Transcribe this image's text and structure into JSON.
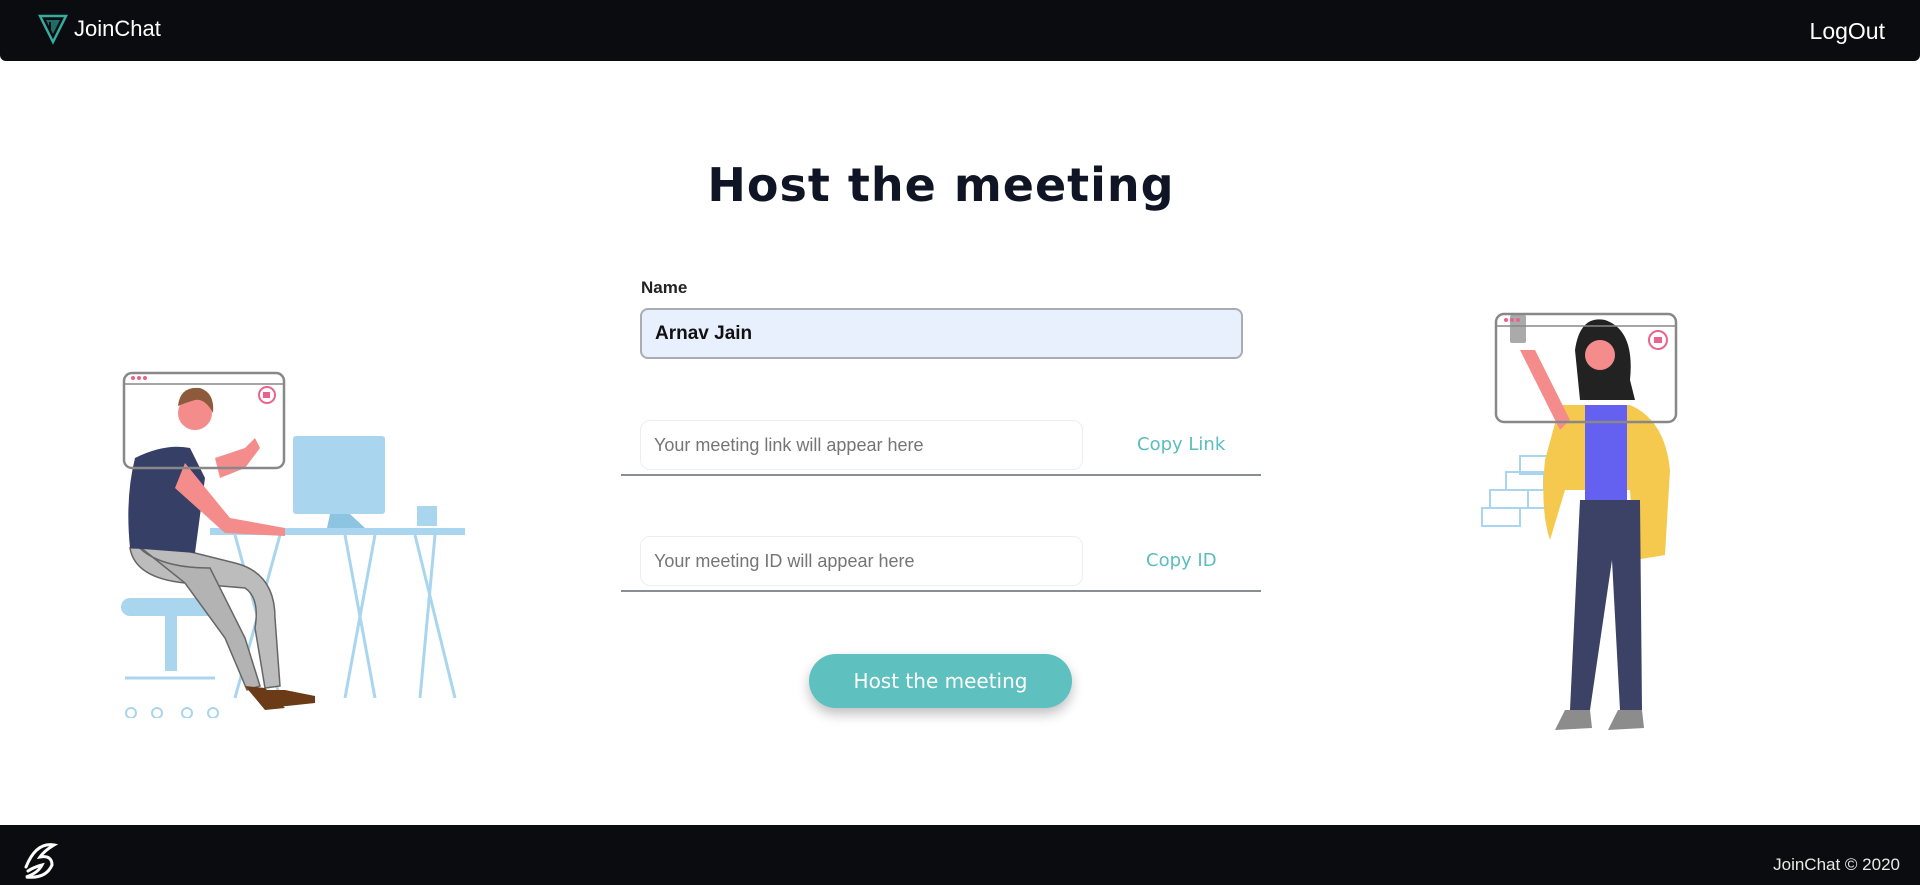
{
  "navbar": {
    "brand": "JoinChat",
    "logout_label": "LogOut"
  },
  "page": {
    "title": "Host the meeting"
  },
  "form": {
    "name_label": "Name",
    "name_value": "Arnav Jain",
    "link_placeholder": "Your meeting link will appear here",
    "copy_link_label": "Copy Link",
    "id_placeholder": "Your meeting ID will appear here",
    "copy_id_label": "Copy ID",
    "host_button_label": "Host the meeting"
  },
  "footer": {
    "copyright": "JoinChat © 2020"
  },
  "colors": {
    "navbar_bg": "#0b0c10",
    "accent_teal": "#5ec0bf",
    "input_bg": "#e8f0fe",
    "title_color": "#0f1525"
  },
  "icons": {
    "brand": "joinchat-logo-icon",
    "footer": "signature-logo-icon"
  }
}
